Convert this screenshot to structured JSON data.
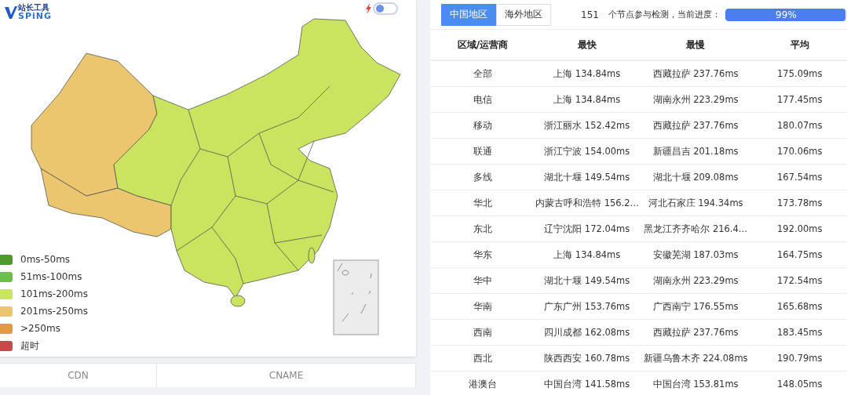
{
  "logo": {
    "top": "站长工具",
    "bottom": "SPiNG"
  },
  "toggle": {
    "on": false
  },
  "legend": [
    {
      "label": "0ms-50ms",
      "color": "#4e9a2e"
    },
    {
      "label": "51ms-100ms",
      "color": "#6cc04a"
    },
    {
      "label": "101ms-200ms",
      "color": "#c9e45e"
    },
    {
      "label": "201ms-250ms",
      "color": "#ebc66e"
    },
    {
      "label": ">250ms",
      "color": "#e39a45"
    },
    {
      "label": "超时",
      "color": "#c9484a"
    }
  ],
  "cdn_table": {
    "columns": [
      "CDN",
      "CNAME"
    ]
  },
  "tabs": [
    {
      "label": "中国地区",
      "selected": true
    },
    {
      "label": "海外地区",
      "selected": false
    }
  ],
  "status": {
    "count": "151",
    "text": "个节点参与检测，当前进度：",
    "progress": {
      "level": 0.99,
      "label": "99%"
    }
  },
  "table": {
    "columns": [
      "区域/运营商",
      "最快",
      "最慢",
      "平均"
    ],
    "rows": [
      [
        "全部",
        "上海 134.84ms",
        "西藏拉萨 237.76ms",
        "175.09ms"
      ],
      [
        "电信",
        "上海 134.84ms",
        "湖南永州 223.29ms",
        "177.45ms"
      ],
      [
        "移动",
        "浙江丽水 152.42ms",
        "西藏拉萨 237.76ms",
        "180.07ms"
      ],
      [
        "联通",
        "浙江宁波 154.00ms",
        "新疆昌吉 201.18ms",
        "170.06ms"
      ],
      [
        "多线",
        "湖北十堰 149.54ms",
        "湖北十堰 209.08ms",
        "167.54ms"
      ],
      [
        "华北",
        "内蒙古呼和浩特 156.2...",
        "河北石家庄 194.34ms",
        "173.78ms"
      ],
      [
        "东北",
        "辽宁沈阳 172.04ms",
        "黑龙江齐齐哈尔 216.4...",
        "192.00ms"
      ],
      [
        "华东",
        "上海 134.84ms",
        "安徽芜湖 187.03ms",
        "164.75ms"
      ],
      [
        "华中",
        "湖北十堰 149.54ms",
        "湖南永州 223.29ms",
        "172.54ms"
      ],
      [
        "华南",
        "广东广州 153.76ms",
        "广西南宁 176.55ms",
        "165.68ms"
      ],
      [
        "西南",
        "四川成都 162.08ms",
        "西藏拉萨 237.76ms",
        "183.45ms"
      ],
      [
        "西北",
        "陕西西安 160.78ms",
        "新疆乌鲁木齐 224.08ms",
        "190.79ms"
      ],
      [
        "港澳台",
        "中国台湾 141.58ms",
        "中国台湾 153.81ms",
        "148.05ms"
      ]
    ]
  }
}
